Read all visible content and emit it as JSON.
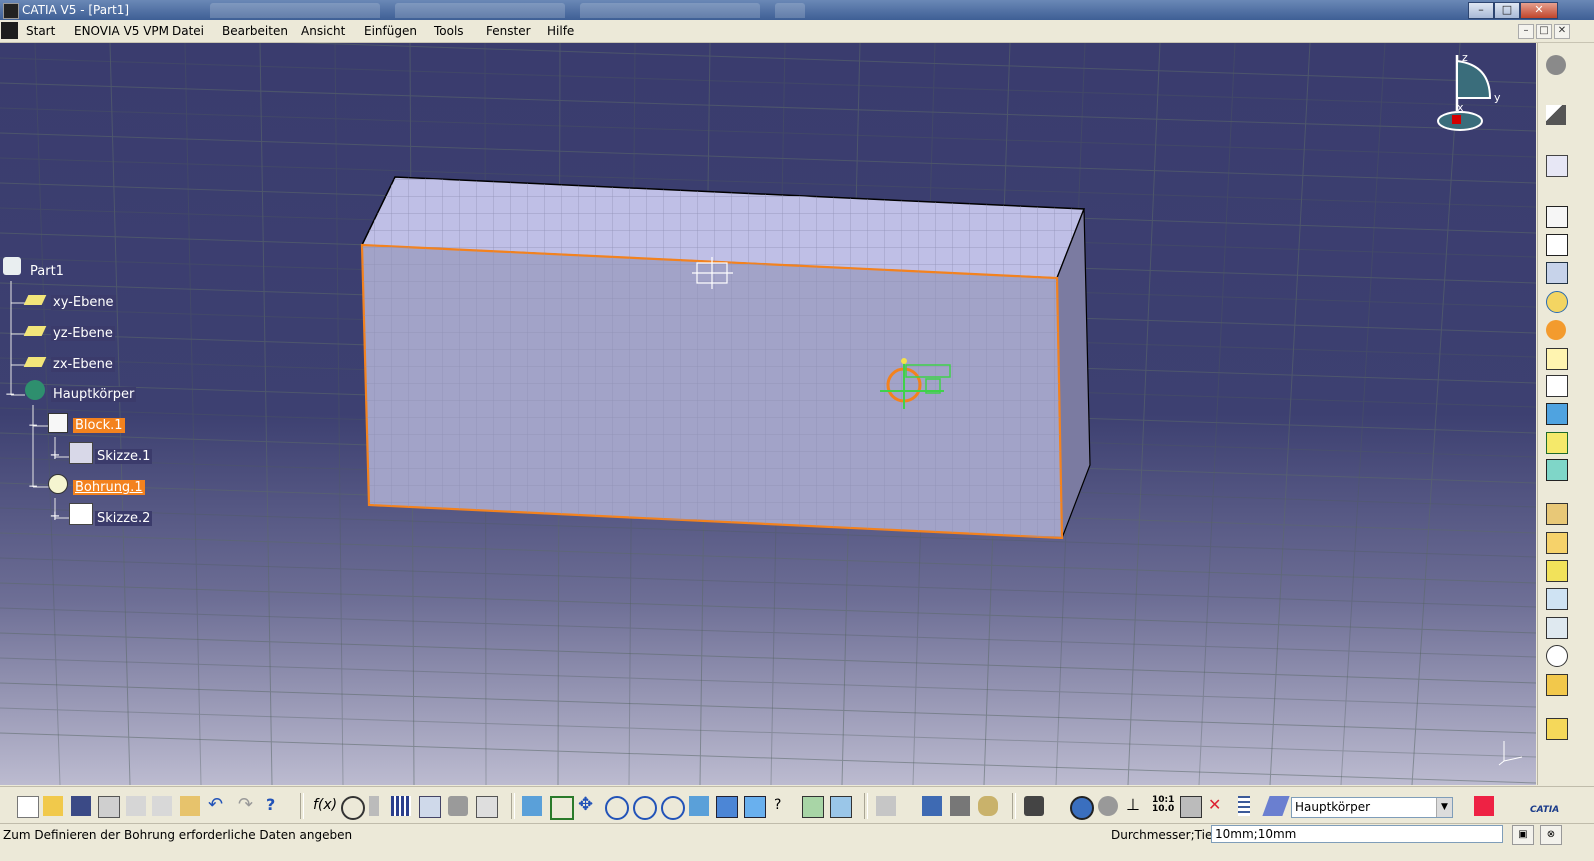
{
  "window": {
    "title": "CATIA V5 - [Part1]",
    "minimize": "–",
    "maximize": "□",
    "close": "✕"
  },
  "menu": {
    "items": [
      "Start",
      "ENOVIA V5 VPM",
      "Datei",
      "Bearbeiten",
      "Ansicht",
      "Einfügen",
      "Tools",
      "Fenster",
      "Hilfe"
    ],
    "doc_min": "–",
    "doc_restore": "□",
    "doc_close": "✕"
  },
  "tree": {
    "root": "Part1",
    "planes": [
      "xy-Ebene",
      "yz-Ebene",
      "zx-Ebene"
    ],
    "body": "Hauptkörper",
    "features": [
      {
        "label": "Block.1",
        "child": "Skizze.1"
      },
      {
        "label": "Bohrung.1",
        "child": "Skizze.2"
      }
    ]
  },
  "compass": {
    "x": "x",
    "y": "y",
    "z": "z"
  },
  "toolbar": {
    "body_select": "Hauptkörper",
    "catia_logo": "CATIA"
  },
  "status": {
    "message": "Zum Definieren der Bohrung erforderliche Daten angeben",
    "param_label": "Durchmesser;Tiefe",
    "param_value": "10mm;10mm"
  },
  "colors": {
    "viewport_top": "#3a3c6e",
    "viewport_bottom": "#bcbbd0",
    "selection": "#f3821e",
    "block_face": "#a2a3c8",
    "block_top": "#bfbfe6",
    "block_side": "#7b7ba1"
  }
}
